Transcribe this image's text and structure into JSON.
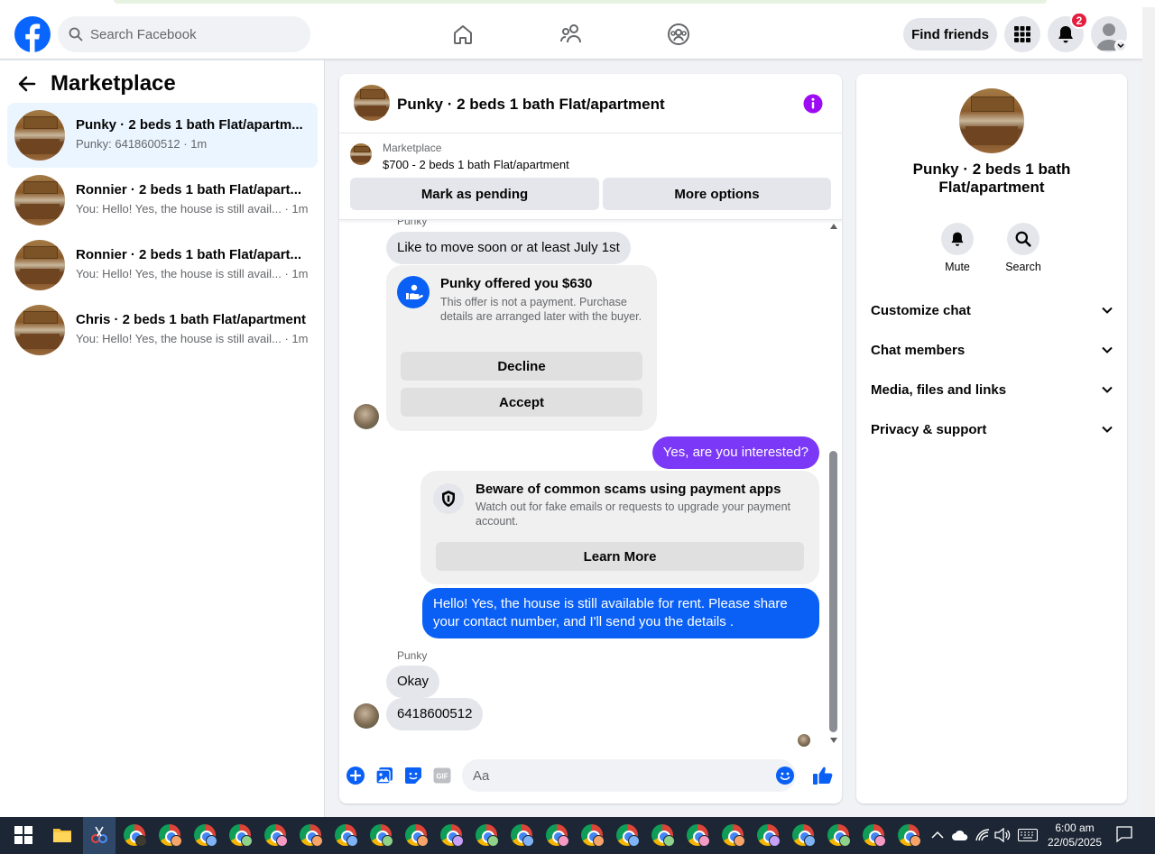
{
  "header": {
    "search_placeholder": "Search Facebook",
    "find_friends_label": "Find friends",
    "notification_count": "2"
  },
  "sidebar": {
    "title": "Marketplace",
    "conversations": [
      {
        "title": "Punky · 2 beds 1 bath Flat/apartm...",
        "subtitle": "Punky: 6418600512 · 1m",
        "active": true
      },
      {
        "title": "Ronnier · 2 beds 1 bath Flat/apart...",
        "subtitle": "You: Hello! Yes, the house is still avail... · 1m",
        "active": false
      },
      {
        "title": "Ronnier · 2 beds 1 bath Flat/apart...",
        "subtitle": "You: Hello! Yes, the house is still avail... · 1m",
        "active": false
      },
      {
        "title": "Chris · 2 beds 1 bath Flat/apartment",
        "subtitle": "You: Hello! Yes, the house is still avail... · 1m",
        "active": false
      }
    ]
  },
  "chat": {
    "title": "Punky · 2 beds 1 bath Flat/apartment",
    "marketplace_label": "Marketplace",
    "listing": "$700 - 2 beds 1 bath Flat/apartment",
    "mark_pending_label": "Mark as pending",
    "more_options_label": "More options",
    "sender_name": "Punky",
    "msg_move": "Like to move soon or at least July 1st",
    "offer": {
      "title": "Punky offered you $630",
      "description": "This offer is not a payment. Purchase details are arranged later with the buyer.",
      "decline_label": "Decline",
      "accept_label": "Accept"
    },
    "msg_interested": "Yes, are you interested?",
    "scam": {
      "title": "Beware of common scams using payment apps",
      "description": "Watch out for fake emails or requests to upgrade your payment account.",
      "learn_more_label": "Learn More"
    },
    "msg_available": "Hello! Yes, the house is still available for rent. Please share your contact number, and I'll send you the details .",
    "msg_okay": "Okay",
    "msg_number": "6418600512",
    "composer_placeholder": "Aa"
  },
  "info_panel": {
    "title": "Punky · 2 beds 1 bath Flat/apartment",
    "mute_label": "Mute",
    "search_label": "Search",
    "sections": [
      "Customize chat",
      "Chat members",
      "Media, files and links",
      "Privacy & support"
    ]
  },
  "taskbar": {
    "time": "6:00 am",
    "date": "22/05/2025"
  },
  "colors": {
    "brand": "#0866ff",
    "outgoing_bubble": "#0a60f5",
    "accent_violet": "#7b38f6",
    "badge": "#e41e3f"
  }
}
